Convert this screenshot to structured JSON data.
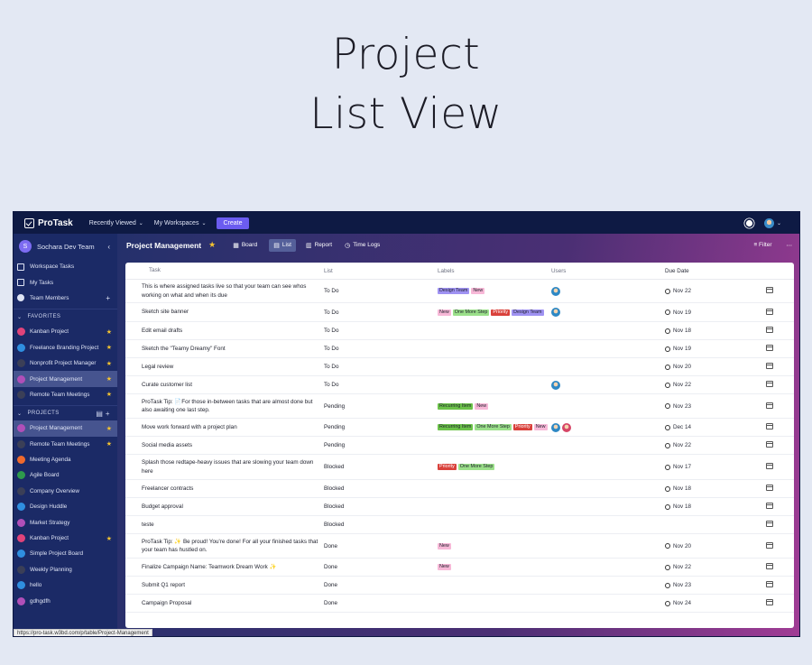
{
  "hero": {
    "line1": "Project",
    "line2": "List View"
  },
  "topbar": {
    "brand": "ProTask",
    "recently_viewed": "Recently Viewed",
    "my_workspaces": "My Workspaces",
    "create": "Create"
  },
  "sidebar": {
    "team_initial": "S",
    "team_name": "Sochara Dev Team",
    "nav": [
      {
        "label": "Workspace Tasks"
      },
      {
        "label": "My Tasks"
      },
      {
        "label": "Team Members"
      }
    ],
    "favorites_heading": "FAVORITES",
    "favorites": [
      {
        "label": "Kanban Project",
        "color": "#e0437a"
      },
      {
        "label": "Freelance Branding Project",
        "color": "#2f8fe0"
      },
      {
        "label": "Nonprofit Project Manager",
        "color": "#3b3f57"
      },
      {
        "label": "Project Management",
        "color": "#b04fb8"
      },
      {
        "label": "Remote Team Meetings",
        "color": "#3b3f57"
      }
    ],
    "projects_heading": "PROJECTS",
    "projects": [
      {
        "label": "Project Management",
        "color": "#b04fb8",
        "star": true
      },
      {
        "label": "Remote Team Meetings",
        "color": "#3b3f57",
        "star": true
      },
      {
        "label": "Meeting Agenda",
        "color": "#f06a2d",
        "star": false
      },
      {
        "label": "Agile Board",
        "color": "#2e9a4c",
        "star": false
      },
      {
        "label": "Company Overview",
        "color": "#3b3f57",
        "star": false
      },
      {
        "label": "Design Huddle",
        "color": "#2f8fe0",
        "star": false
      },
      {
        "label": "Market Strategy",
        "color": "#b04fb8",
        "star": false
      },
      {
        "label": "Kanban Project",
        "color": "#e0437a",
        "star": true
      },
      {
        "label": "Simple Project Board",
        "color": "#2f8fe0",
        "star": false
      },
      {
        "label": "Weekly Planning",
        "color": "#3b3f57",
        "star": false
      },
      {
        "label": "hello",
        "color": "#2f8fe0",
        "star": false
      },
      {
        "label": "gdhgdfh",
        "color": "#b04fb8",
        "star": false
      }
    ]
  },
  "main": {
    "title": "Project Management",
    "tabs": {
      "board": "Board",
      "list": "List",
      "report": "Report",
      "time_logs": "Time Logs"
    },
    "filter": "Filter",
    "columns": {
      "task": "Task",
      "list": "List",
      "labels": "Labels",
      "users": "Users",
      "due": "Due Date"
    }
  },
  "label_colors": {
    "Design Team": "#9f92f2",
    "New": "#f7b8d7",
    "One More Step": "#9be08a",
    "Priority": "#d9413b",
    "Recurring Item": "#6cc24a"
  },
  "rows": [
    {
      "task": "This is where assigned tasks live so that your team can see whos working on what and when its due",
      "list": "To Do",
      "labels": [
        "Design Team",
        "New"
      ],
      "users": [
        "blue"
      ],
      "due": "Nov 22",
      "h": 26
    },
    {
      "task": "Sketch site banner",
      "list": "To Do",
      "labels": [
        "New",
        "One More Step",
        "Priority",
        "Design Team"
      ],
      "users": [
        "blue"
      ],
      "due": "Nov 19",
      "h": 21
    },
    {
      "task": "Edit email drafts",
      "list": "To Do",
      "labels": [],
      "users": [],
      "due": "Nov 18",
      "h": 20
    },
    {
      "task": "Sketch the \"Teamy Dreamy\" Font",
      "list": "To Do",
      "labels": [],
      "users": [],
      "due": "Nov 19",
      "h": 20
    },
    {
      "task": "Legal review",
      "list": "To Do",
      "labels": [],
      "users": [],
      "due": "Nov 20",
      "h": 20
    },
    {
      "task": "Curate customer list",
      "list": "To Do",
      "labels": [],
      "users": [
        "blue"
      ],
      "due": "Nov 22",
      "h": 20
    },
    {
      "task": "ProTask Tip: 📄For those in-between tasks that are almost done but also awaiting one last step.",
      "list": "Pending",
      "labels": [
        "Recurring Item",
        "New"
      ],
      "users": [],
      "due": "Nov 23",
      "h": 27
    },
    {
      "task": "Move work forward with a project plan",
      "list": "Pending",
      "labels": [
        "Recurring Item",
        "One More Step",
        "Priority",
        "New"
      ],
      "users": [
        "blue",
        "red"
      ],
      "due": "Dec 14",
      "h": 20
    },
    {
      "task": "Social media assets",
      "list": "Pending",
      "labels": [],
      "users": [],
      "due": "Nov 22",
      "h": 20
    },
    {
      "task": "Splash those redtape-heavy issues that are slowing your team down here",
      "list": "Blocked",
      "labels": [
        "Priority",
        "One More Step"
      ],
      "users": [],
      "due": "Nov 17",
      "h": 28
    },
    {
      "task": "Freelancer contracts",
      "list": "Blocked",
      "labels": [],
      "users": [],
      "due": "Nov 18",
      "h": 20
    },
    {
      "task": "Budget approval",
      "list": "Blocked",
      "labels": [],
      "users": [],
      "due": "Nov 18",
      "h": 20
    },
    {
      "task": "teste",
      "list": "Blocked",
      "labels": [],
      "users": [],
      "due": "",
      "h": 20
    },
    {
      "task": "ProTask Tip: ✨ Be proud! You're done! For all your finished tasks that your team has hustled on.",
      "list": "Done",
      "labels": [
        "New"
      ],
      "users": [],
      "due": "Nov 20",
      "h": 27
    },
    {
      "task": "Finalize Campaign Name: Teamwork Dream Work ✨",
      "list": "Done",
      "labels": [
        "New"
      ],
      "users": [],
      "due": "Nov 22",
      "h": 20
    },
    {
      "task": "Submit Q1 report",
      "list": "Done",
      "labels": [],
      "users": [],
      "due": "Nov 23",
      "h": 20
    },
    {
      "task": "Campaign Proposal",
      "list": "Done",
      "labels": [],
      "users": [],
      "due": "Nov 24",
      "h": 20
    }
  ],
  "status_url": "https://pro-task.w3bd.com/p/table/Project-Management"
}
